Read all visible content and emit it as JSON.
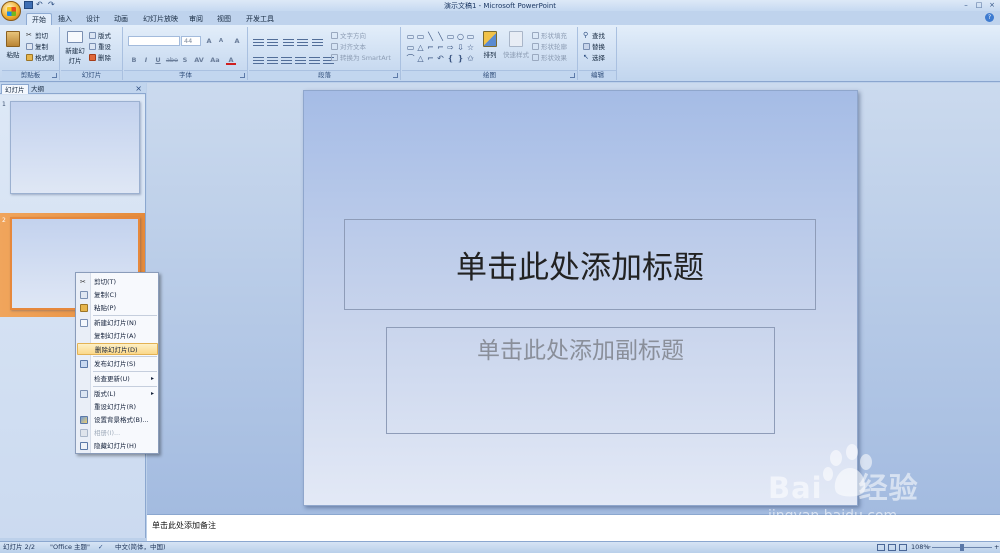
{
  "window": {
    "title": "演示文稿1 - Microsoft PowerPoint",
    "controls": [
      "–",
      "□",
      "×"
    ]
  },
  "qat": {
    "undo": "↶",
    "redo": "↷"
  },
  "tabs": [
    "开始",
    "插入",
    "设计",
    "动画",
    "幻灯片放映",
    "审阅",
    "视图",
    "开发工具"
  ],
  "help": "?",
  "ribbon": {
    "clipboard": {
      "title": "剪贴板",
      "paste": "粘贴",
      "cut": "剪切",
      "copy": "复制",
      "format_painter": "格式刷"
    },
    "slides": {
      "title": "幻灯片",
      "new_slide": "新建幻灯片",
      "layout": "版式",
      "reset": "重设",
      "delete": "删除"
    },
    "font": {
      "title": "字体",
      "size": "44",
      "grow": "A",
      "shrink": "A",
      "clear": "A",
      "bold": "B",
      "italic": "I",
      "underline": "U",
      "strike": "abe",
      "shadow": "S",
      "spacing": "AV",
      "case": "Aa",
      "color": "A"
    },
    "paragraph": {
      "title": "段落",
      "text_direction": "文字方向",
      "align_text": "对齐文本",
      "smartart": "转换为 SmartArt"
    },
    "drawing": {
      "title": "绘图",
      "arrange": "排列",
      "quick_styles": "快速样式",
      "shape_fill": "形状填充",
      "shape_outline": "形状轮廓",
      "shape_effects": "形状效果",
      "shape_glyphs": [
        "▭",
        "▭",
        "╲",
        "╲",
        "▭",
        "○",
        "▭",
        "▭",
        "△",
        "⌐",
        "⌐",
        "⇨",
        "⇩",
        "☆",
        "⌒",
        "△",
        "⌐",
        "↶",
        "❴",
        "❵",
        "✩"
      ]
    },
    "editing": {
      "title": "编辑",
      "find": "查找",
      "replace": "替换",
      "select": "选择"
    }
  },
  "left_pane": {
    "tabs": [
      "幻灯片",
      "大纲"
    ],
    "close": "×",
    "slides": [
      {
        "number": "1"
      },
      {
        "number": "2"
      }
    ]
  },
  "context_menu": {
    "items": [
      {
        "label": "剪切(T)",
        "icon": "cut-icon",
        "enabled": true
      },
      {
        "label": "复制(C)",
        "icon": "copy-icon",
        "enabled": true
      },
      {
        "label": "粘贴(P)",
        "icon": "paste-icon",
        "enabled": true
      },
      {
        "label": "新建幻灯片(N)",
        "icon": "new-slide-icon",
        "enabled": true
      },
      {
        "label": "复制幻灯片(A)",
        "icon": "",
        "enabled": true
      },
      {
        "label": "删除幻灯片(D)",
        "icon": "",
        "enabled": true,
        "highlighted": true
      },
      {
        "label": "发布幻灯片(S)",
        "icon": "publish-icon",
        "enabled": true
      },
      {
        "label": "检查更新(U)",
        "icon": "",
        "enabled": true,
        "submenu": true
      },
      {
        "label": "版式(L)",
        "icon": "layout-icon",
        "enabled": true,
        "submenu": true
      },
      {
        "label": "重设幻灯片(R)",
        "icon": "",
        "enabled": true
      },
      {
        "label": "设置背景格式(B)...",
        "icon": "background-icon",
        "enabled": true
      },
      {
        "label": "相册(I)...",
        "icon": "album-icon",
        "enabled": false
      },
      {
        "label": "隐藏幻灯片(H)",
        "icon": "hide-slide-icon",
        "enabled": true
      }
    ],
    "submenu_arrow": "▸"
  },
  "slide": {
    "title_placeholder": "单击此处添加标题",
    "subtitle_placeholder": "单击此处添加副标题"
  },
  "notes": {
    "placeholder": "单击此处添加备注"
  },
  "status_bar": {
    "slide_count": "幻灯片 2/2",
    "theme": "\"Office 主题\"",
    "language": "中文(简体，中国)",
    "zoom": "108%",
    "zoom_fraction": 0.5,
    "minus": "−",
    "plus": "+"
  },
  "watermark": {
    "brand": "Bai",
    "brand2": "经验",
    "url": "jingyan.baidu.com"
  }
}
